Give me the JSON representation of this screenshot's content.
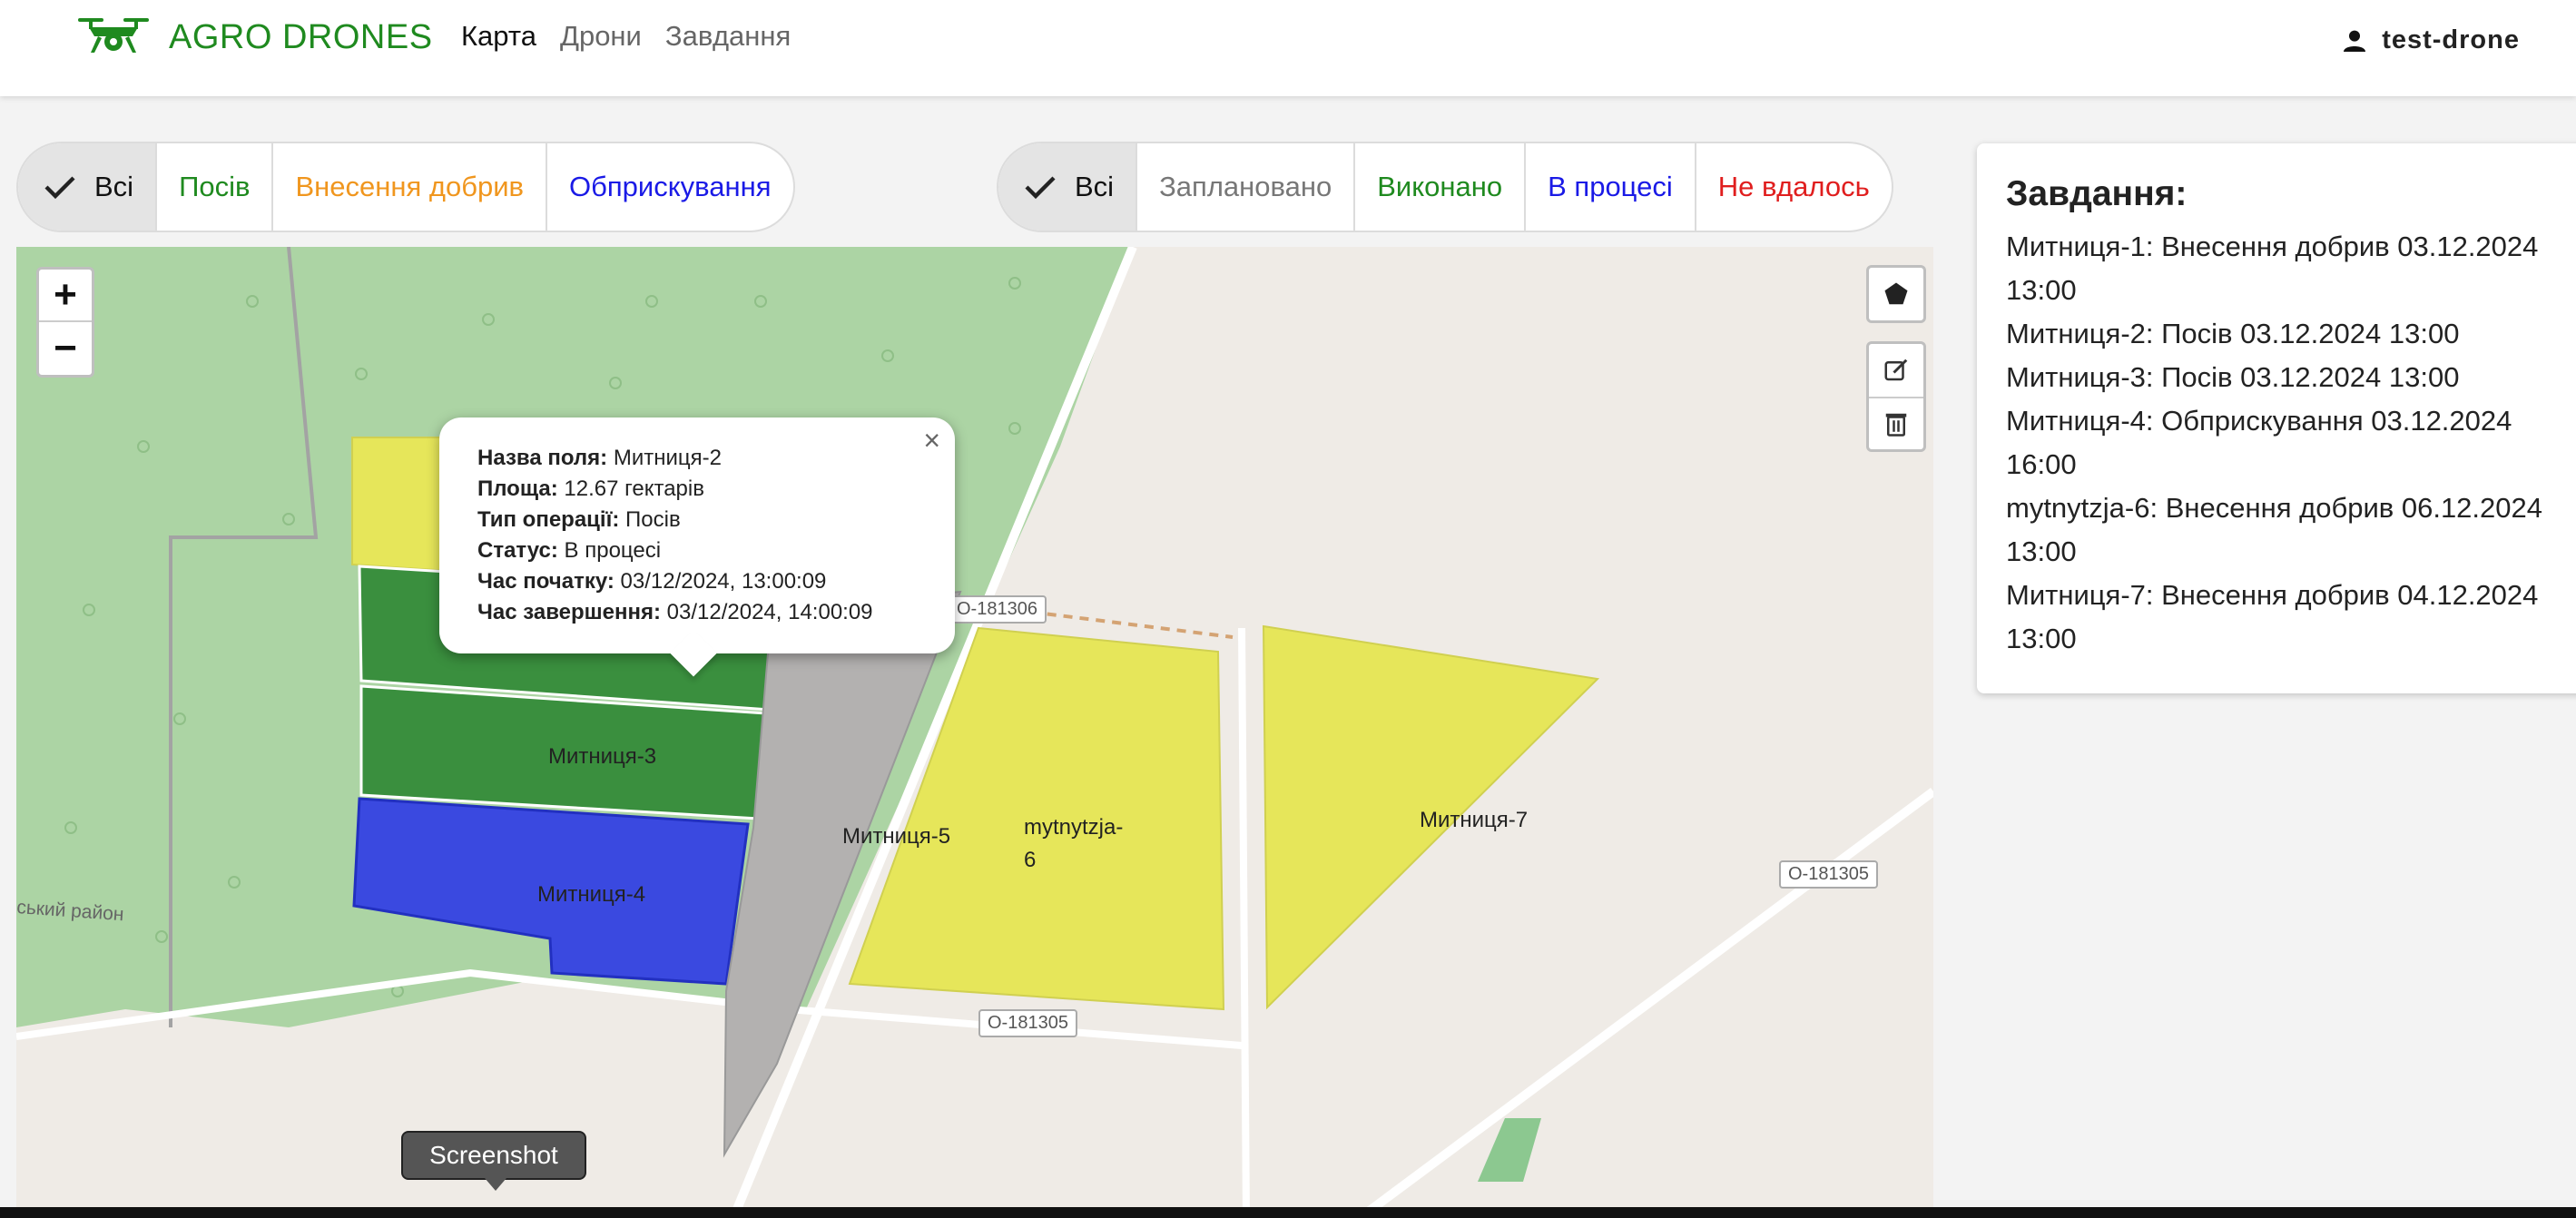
{
  "app": {
    "name": "AGRO DRONES"
  },
  "nav": {
    "items": [
      "Карта",
      "Дрони",
      "Завдання"
    ],
    "active": "Карта"
  },
  "user": {
    "name": "test-drone"
  },
  "type_filter": {
    "selected": "Всі",
    "options": [
      {
        "label": "Всі",
        "color": "#222222"
      },
      {
        "label": "Посів",
        "color": "#1f8a1f"
      },
      {
        "label": "Внесення добрив",
        "color": "#f0961e"
      },
      {
        "label": "Обприскування",
        "color": "#1a1ae6"
      }
    ]
  },
  "status_filter": {
    "selected": "Всі",
    "options": [
      {
        "label": "Всі",
        "color": "#222222"
      },
      {
        "label": "Заплановано",
        "color": "#777777"
      },
      {
        "label": "Виконано",
        "color": "#1f8a1f"
      },
      {
        "label": "В процесі",
        "color": "#1a1ae6"
      },
      {
        "label": "Не вдалось",
        "color": "#e01e1e"
      }
    ]
  },
  "map": {
    "zoom_in": "+",
    "zoom_out": "−",
    "fields": [
      "Митниця-3",
      "Митниця-4",
      "Митниця-5",
      "mytnytzja-",
      "6",
      "Митниця-7"
    ],
    "roads": [
      "O-181306",
      "O-181305",
      "O-181305"
    ],
    "region_text": "ський район",
    "colors": {
      "seeding": "#3a8f3e",
      "spraying": "#3a49e0",
      "fertilizing": "#e6e65a",
      "unassigned": "#b3b1b0",
      "forest": "#acd4a4"
    }
  },
  "popup": {
    "rows": [
      {
        "label": "Назва поля:",
        "value": "Митниця-2"
      },
      {
        "label": "Площа:",
        "value": "12.67 гектарів"
      },
      {
        "label": "Тип операції:",
        "value": "Посів"
      },
      {
        "label": "Статус:",
        "value": "В процесі"
      },
      {
        "label": "Час початку:",
        "value": "03/12/2024, 13:00:09"
      },
      {
        "label": "Час завершення:",
        "value": "03/12/2024, 14:00:09"
      }
    ],
    "close": "×"
  },
  "tasks": {
    "title": "Завдання:",
    "items": [
      "Митниця-1: Внесення добрив 03.12.2024 13:00",
      "Митниця-2: Посів 03.12.2024 13:00",
      "Митниця-3: Посів 03.12.2024 13:00",
      "Митниця-4: Обприскування 03.12.2024 16:00",
      "mytnytzja-6: Внесення добрив 06.12.2024 13:00",
      "Митниця-7: Внесення добрив 04.12.2024 13:00"
    ]
  },
  "tooltip": {
    "text": "Screenshot"
  }
}
